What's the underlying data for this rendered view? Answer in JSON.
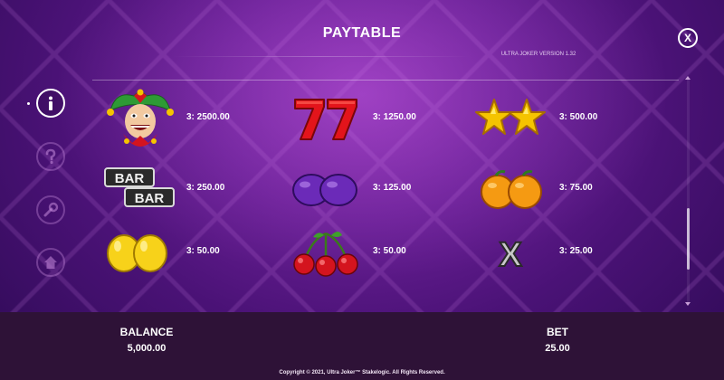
{
  "header": {
    "title": "PAYTABLE",
    "version": "ULTRA JOKER VERSION 1.32",
    "close_label": "X"
  },
  "sidebar": [
    {
      "name": "info",
      "icon": "info-icon",
      "active": true
    },
    {
      "name": "help",
      "icon": "question-icon",
      "active": false
    },
    {
      "name": "settings",
      "icon": "wrench-icon",
      "active": false
    },
    {
      "name": "home",
      "icon": "home-icon",
      "active": false
    }
  ],
  "paytable": [
    {
      "symbol": "joker",
      "payout": "3: 2500.00"
    },
    {
      "symbol": "seven",
      "payout": "3: 1250.00"
    },
    {
      "symbol": "star",
      "payout": "3: 500.00"
    },
    {
      "symbol": "bar",
      "payout": "3: 250.00"
    },
    {
      "symbol": "plum",
      "payout": "3: 125.00"
    },
    {
      "symbol": "orange",
      "payout": "3: 75.00"
    },
    {
      "symbol": "lemon",
      "payout": "3: 50.00"
    },
    {
      "symbol": "cherry",
      "payout": "3: 50.00"
    },
    {
      "symbol": "x",
      "payout": "3: 25.00"
    }
  ],
  "symbol_text": {
    "bar_top": "BAR",
    "bar_bottom": "BAR",
    "x": "X"
  },
  "footer": {
    "balance_label": "BALANCE",
    "balance_value": "5,000.00",
    "bet_label": "BET",
    "bet_value": "25.00",
    "copyright": "Copyright © 2021, Ultra Joker™ Stakelogic. All Rights Reserved."
  },
  "colors": {
    "background": "#5a1a88",
    "bottom_bar": "#2e1237",
    "seven_red": "#e3141b",
    "star_gold": "#f5c400",
    "plum_purple": "#6b2ab8",
    "orange": "#f59a12",
    "lemon": "#f7d21a",
    "cherry_red": "#d4141e"
  }
}
